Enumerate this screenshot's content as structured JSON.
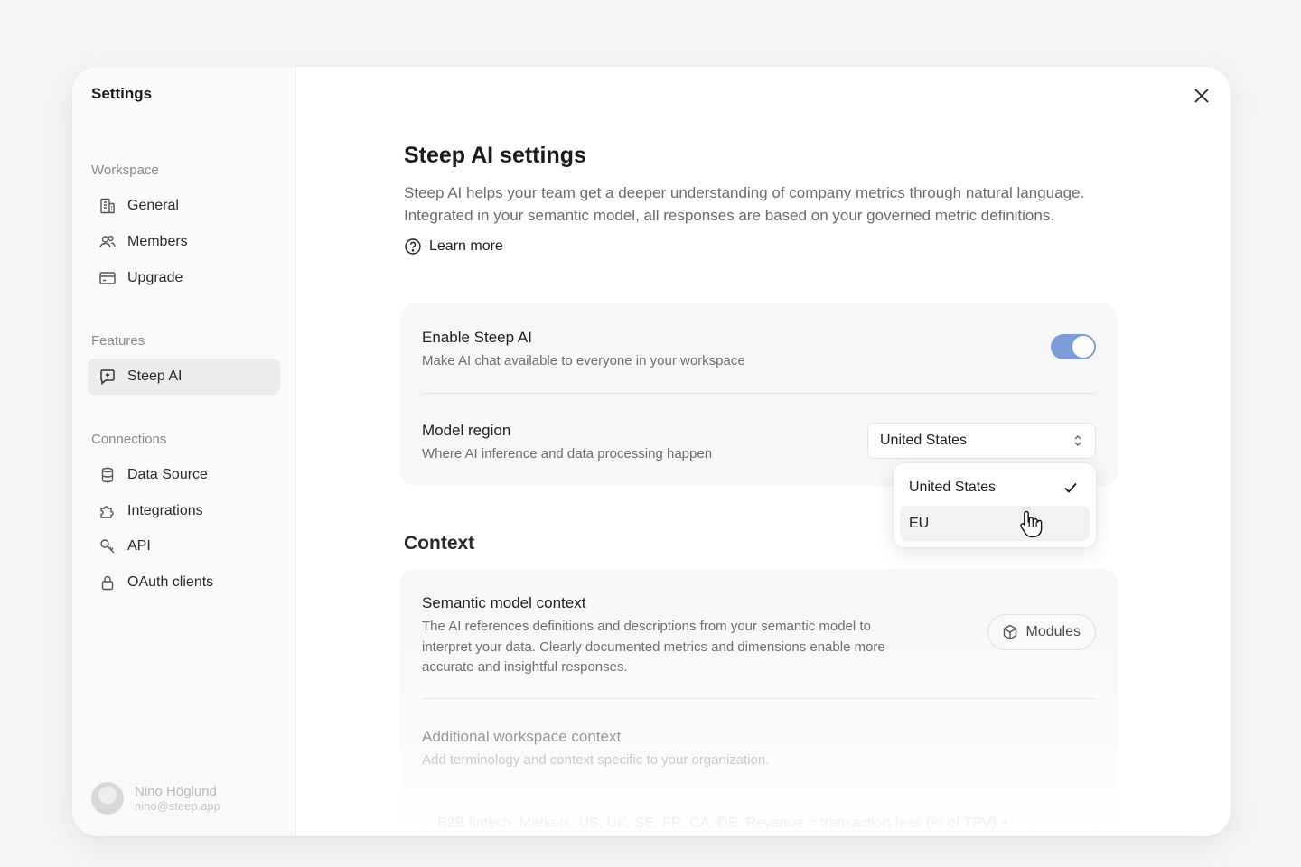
{
  "sidebar": {
    "title": "Settings",
    "sections": [
      {
        "label": "Workspace",
        "items": [
          {
            "label": "General",
            "icon": "building-icon"
          },
          {
            "label": "Members",
            "icon": "users-icon"
          },
          {
            "label": "Upgrade",
            "icon": "credit-card-icon"
          }
        ]
      },
      {
        "label": "Features",
        "items": [
          {
            "label": "Steep AI",
            "icon": "chat-sparkle-icon",
            "active": true
          }
        ]
      },
      {
        "label": "Connections",
        "items": [
          {
            "label": "Data Source",
            "icon": "database-icon"
          },
          {
            "label": "Integrations",
            "icon": "puzzle-icon"
          },
          {
            "label": "API",
            "icon": "key-icon"
          },
          {
            "label": "OAuth clients",
            "icon": "lock-icon"
          }
        ]
      }
    ],
    "user": {
      "name": "Nino Höglund",
      "email": "nino@steep.app"
    }
  },
  "main": {
    "title": "Steep AI settings",
    "description_line1": "Steep AI helps your team get a deeper understanding of company metrics through natural language.",
    "description_line2": "Integrated in your semantic model, all responses are based on your governed metric definitions.",
    "learn_more": "Learn more",
    "enable": {
      "title": "Enable Steep AI",
      "description": "Make AI chat available to everyone in your workspace",
      "enabled": true
    },
    "region": {
      "title": "Model region",
      "description": "Where AI inference and data processing happen",
      "selected": "United States",
      "options": [
        "United States",
        "EU"
      ],
      "hovered": "EU"
    },
    "context": {
      "title": "Context",
      "semantic": {
        "title": "Semantic model context",
        "description_line1": "The AI references definitions and descriptions from your semantic model to",
        "description_line2": "interpret your data. Clearly documented metrics and dimensions enable more",
        "description_line3": "accurate and insightful responses.",
        "button": "Modules"
      },
      "additional": {
        "title": "Additional workspace context",
        "description": "Add terminology and context specific to your organization.",
        "value": "B2B fintech. Markets: US, UK, SE, FR, CA, DE. Revenue = transaction fees (% of TPV) +"
      }
    }
  },
  "colors": {
    "accent": "#7b9ed8",
    "active_nav": "#ececec"
  }
}
